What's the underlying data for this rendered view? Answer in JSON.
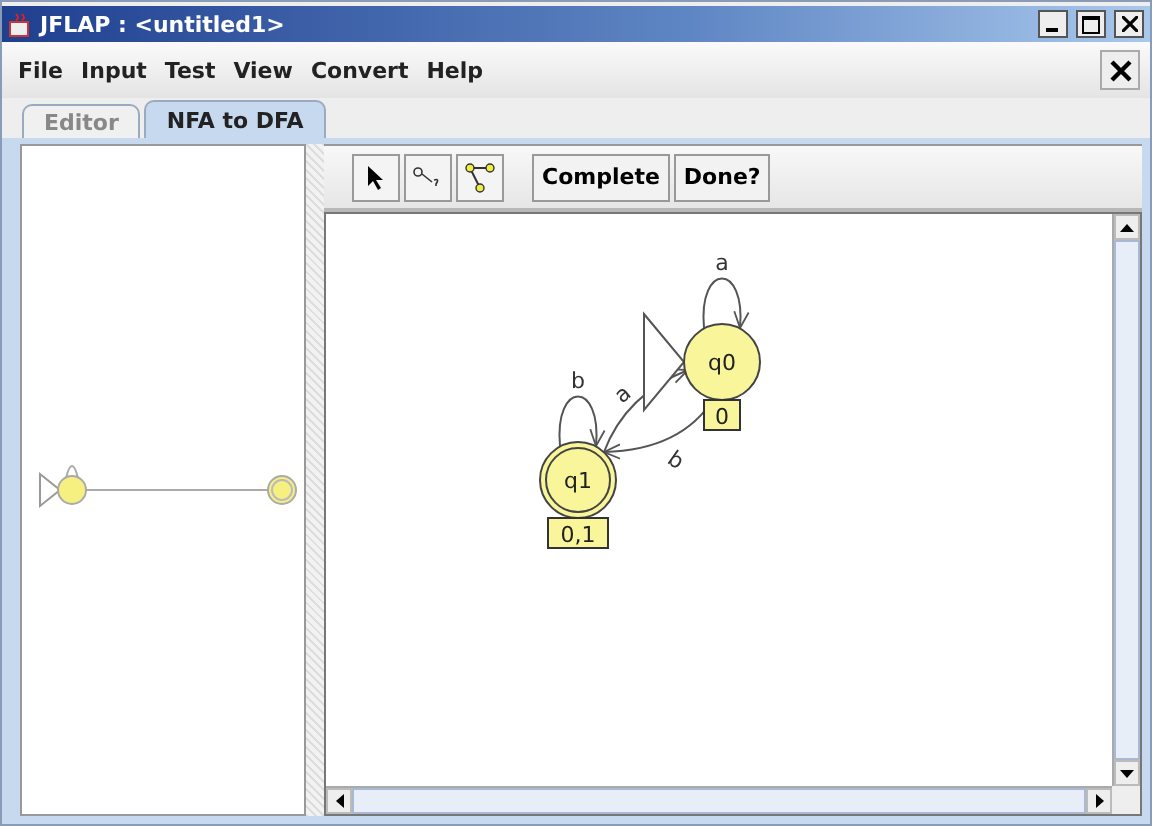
{
  "window": {
    "title": "JFLAP : <untitled1>"
  },
  "menu": [
    "File",
    "Input",
    "Test",
    "View",
    "Convert",
    "Help"
  ],
  "tabs": [
    {
      "label": "Editor",
      "selected": false
    },
    {
      "label": "NFA to DFA",
      "selected": true
    }
  ],
  "toolbar": {
    "buttons": [
      "Complete",
      "Done?"
    ]
  },
  "dfa": {
    "states": [
      {
        "name": "q0",
        "label": "0",
        "initial": true,
        "final": false
      },
      {
        "name": "q1",
        "label": "0,1",
        "initial": false,
        "final": true
      }
    ],
    "transitions": [
      {
        "symbol": "a"
      },
      {
        "symbol": "b"
      },
      {
        "symbol": "a"
      },
      {
        "symbol": "b"
      }
    ]
  }
}
